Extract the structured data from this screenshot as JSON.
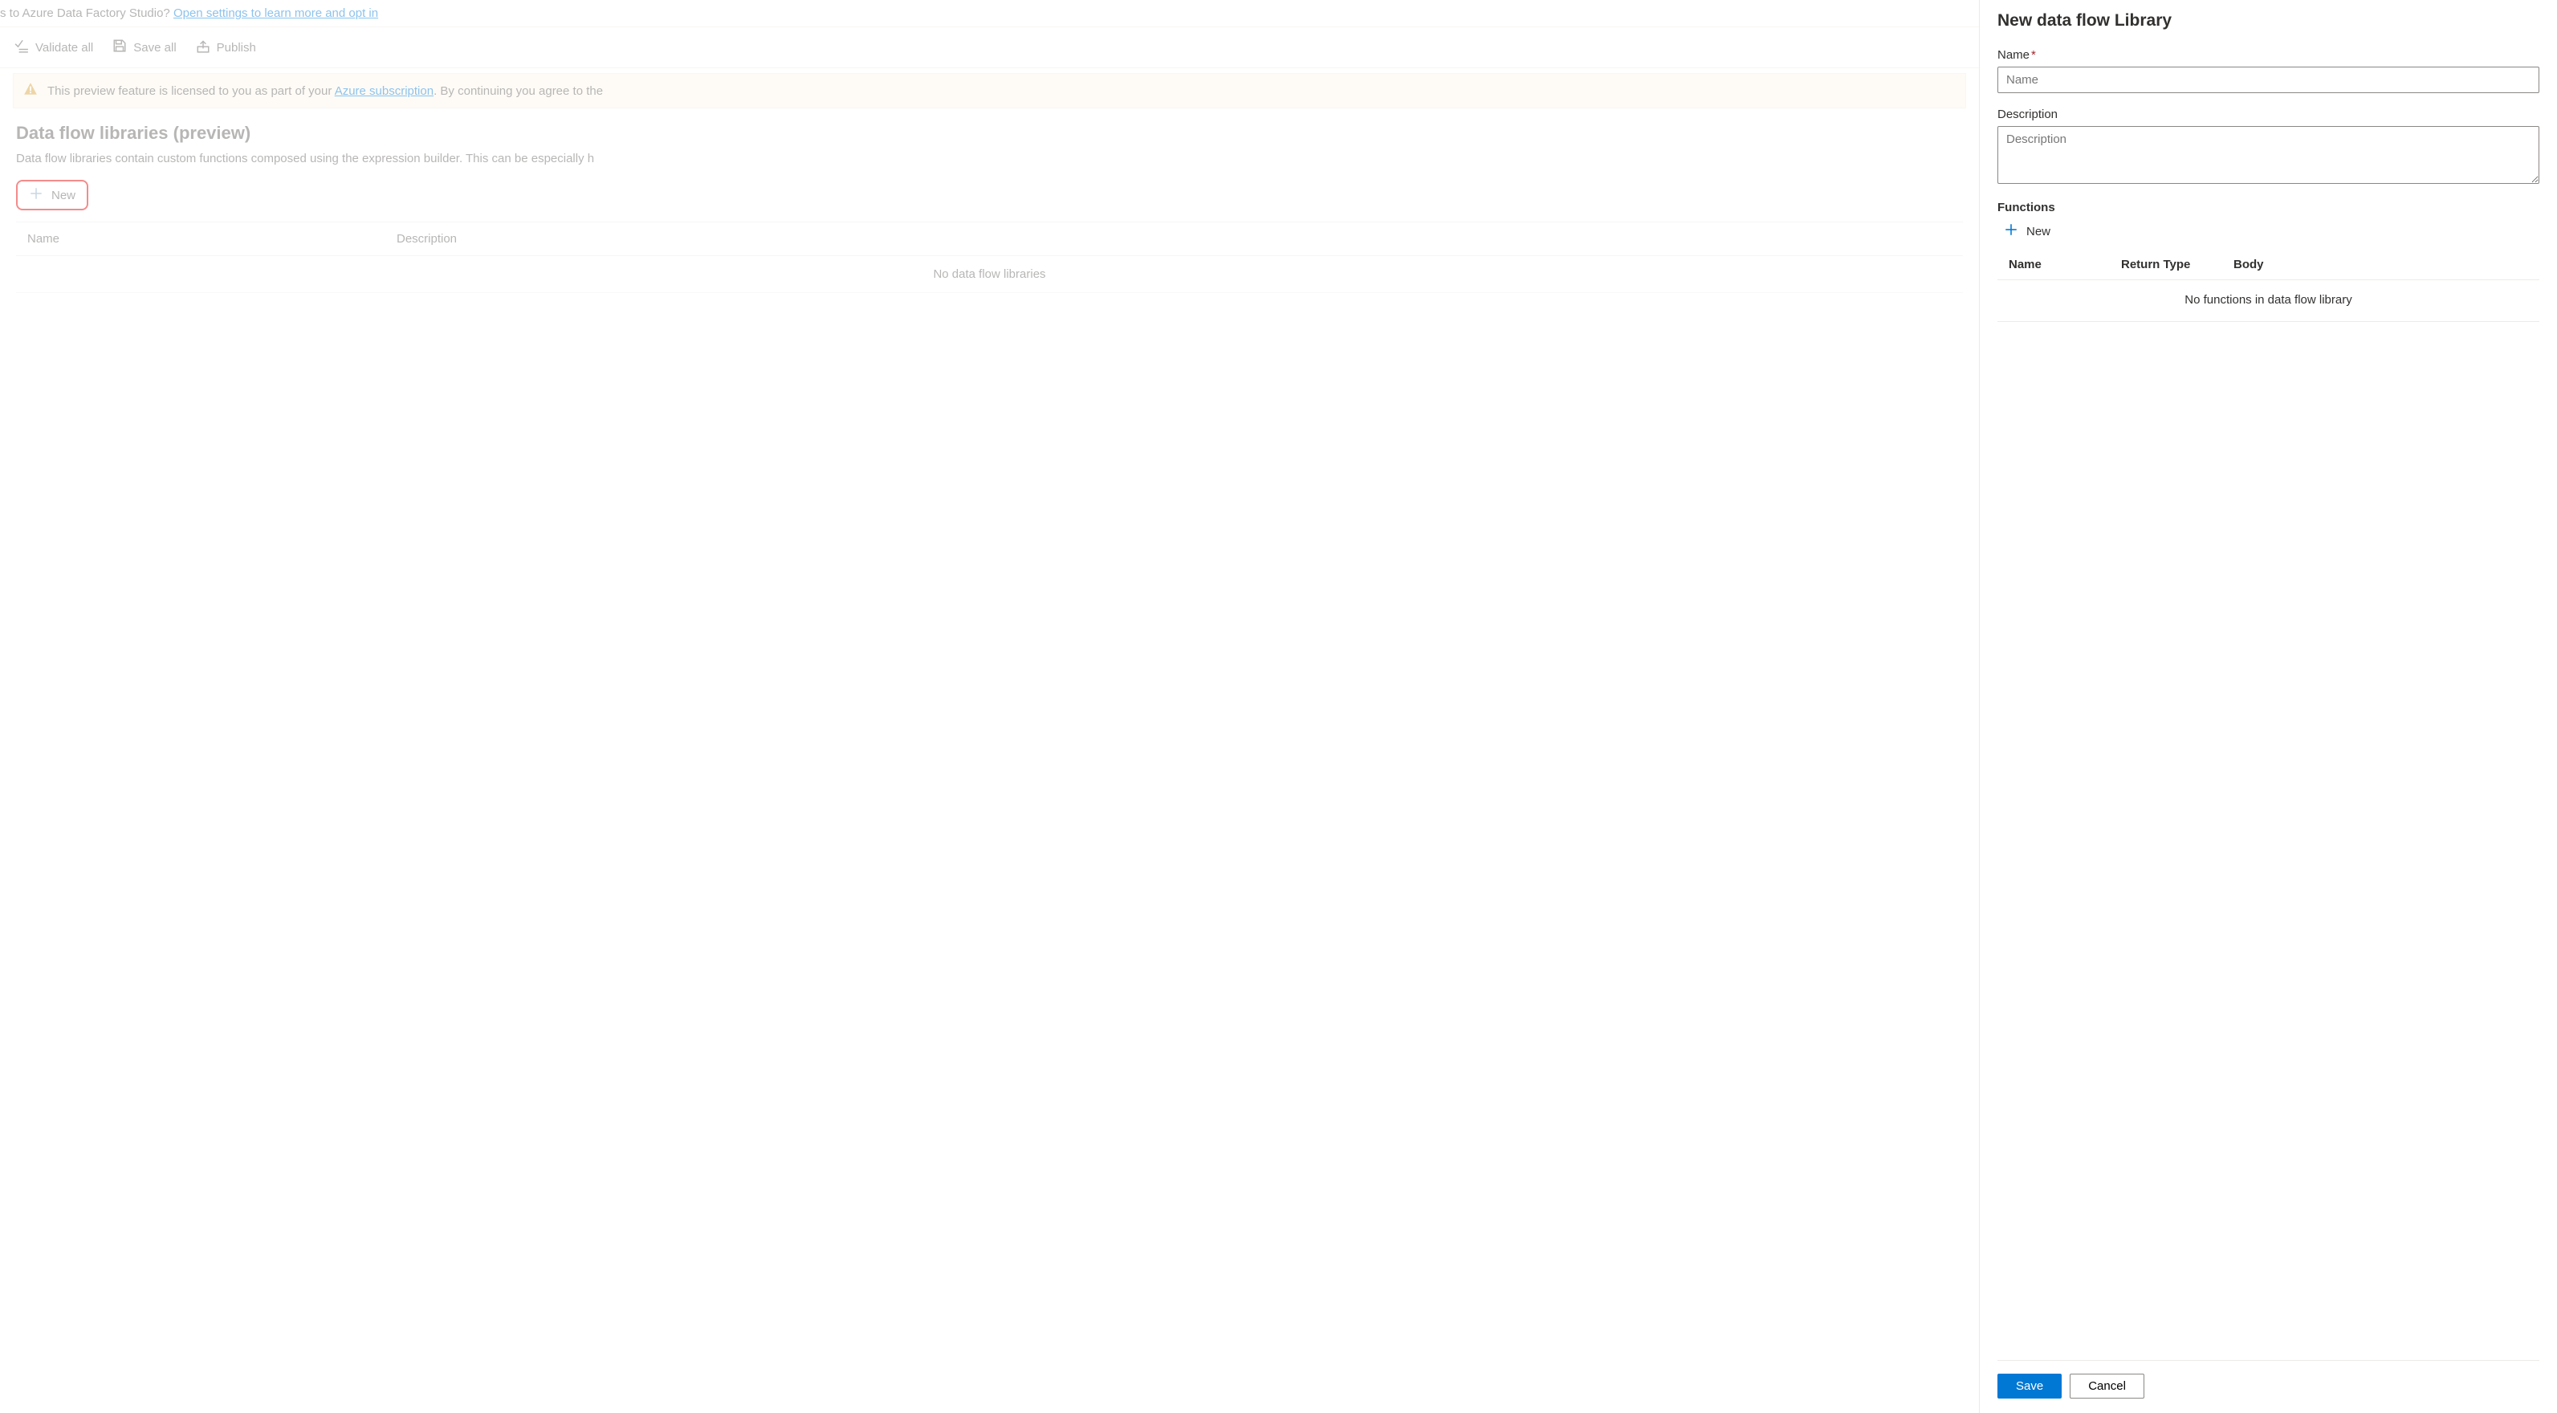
{
  "topBanner": {
    "textPrefix": "s to Azure Data Factory Studio? ",
    "linkText": "Open settings to learn more and opt in"
  },
  "toolbar": {
    "validateAll": "Validate all",
    "saveAll": "Save all",
    "publish": "Publish"
  },
  "infoBanner": {
    "textBefore": "This preview feature is licensed to you as part of your ",
    "linkText": "Azure subscription",
    "textAfter": ". By continuing you agree to the"
  },
  "page": {
    "title": "Data flow libraries (preview)",
    "description": "Data flow libraries contain custom functions composed using the expression builder. This can be especially h",
    "newButton": "New",
    "columns": {
      "name": "Name",
      "description": "Description"
    },
    "emptyMessage": "No data flow libraries"
  },
  "panel": {
    "title": "New data flow Library",
    "nameLabel": "Name",
    "namePlaceholder": "Name",
    "descriptionLabel": "Description",
    "descriptionPlaceholder": "Description",
    "functionsLabel": "Functions",
    "newFunction": "New",
    "funcColumns": {
      "name": "Name",
      "returnType": "Return Type",
      "body": "Body"
    },
    "funcEmptyMessage": "No functions in data flow library",
    "saveLabel": "Save",
    "cancelLabel": "Cancel"
  }
}
